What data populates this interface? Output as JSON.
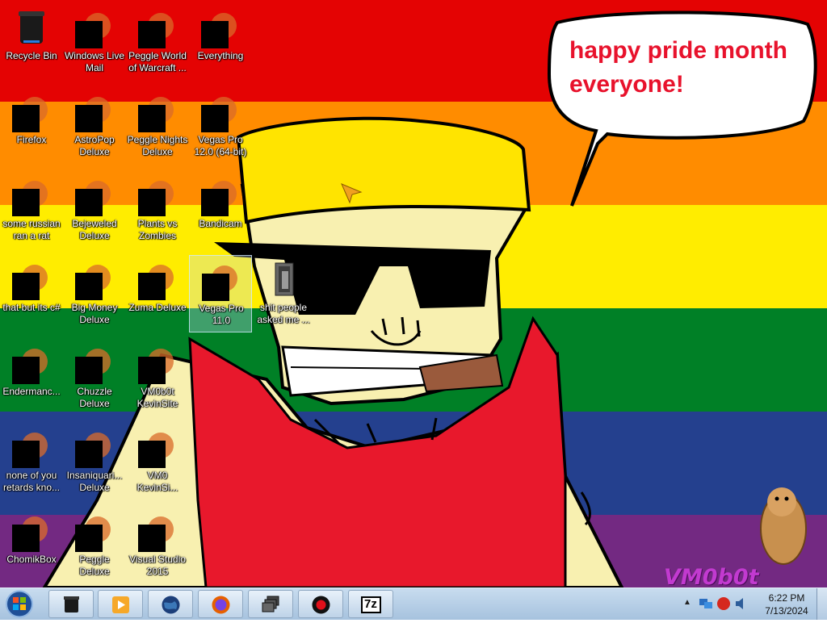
{
  "wallpaper": {
    "speech_bubble": "happy pride month everyone!",
    "watermark": "VM0b0t"
  },
  "desktop_icons": [
    {
      "label": "Recycle Bin",
      "icon": "recycle-bin-icon",
      "censored": false
    },
    {
      "label": "Windows Live Mail",
      "icon": "mail-icon",
      "censored": true
    },
    {
      "label": "Peggle World of Warcraft ...",
      "icon": "peggle-icon",
      "censored": true
    },
    {
      "label": "Everything",
      "icon": "search-icon",
      "censored": true
    },
    {
      "label": "Firefox",
      "icon": "firefox-icon",
      "censored": true
    },
    {
      "label": "AstroPop Deluxe",
      "icon": "game-icon",
      "censored": true
    },
    {
      "label": "Peggle Nights Deluxe",
      "icon": "peggle-icon",
      "censored": true
    },
    {
      "label": "Vegas Pro 12.0 (64-bit)",
      "icon": "vegas-icon",
      "censored": true
    },
    {
      "label": "some russian ran a rat",
      "icon": "app-icon",
      "censored": true
    },
    {
      "label": "Bejeweled Deluxe",
      "icon": "gem-icon",
      "censored": true
    },
    {
      "label": "Plants vs Zombies",
      "icon": "plant-icon",
      "censored": true
    },
    {
      "label": "Bandicam",
      "icon": "record-icon",
      "censored": true
    },
    {
      "label": "that but its c#",
      "icon": "window-stack-icon",
      "censored": true
    },
    {
      "label": "Big Money Deluxe",
      "icon": "money-bag-icon",
      "censored": true
    },
    {
      "label": "Zuma Deluxe",
      "icon": "zuma-icon",
      "censored": true
    },
    {
      "label": "Vegas Pro 11.0",
      "icon": "vegas-icon",
      "censored": true,
      "selected": true
    },
    {
      "label": "shit people asked me ...",
      "icon": "folder-icon",
      "censored": false
    },
    {
      "label": "Endermanc...",
      "icon": "terminal-icon",
      "censored": true
    },
    {
      "label": "Chuzzle Deluxe",
      "icon": "chuzzle-icon",
      "censored": true
    },
    {
      "label": "VM0b0t KevinSite",
      "icon": "terminal-icon",
      "censored": true
    },
    {
      "label": "none of you retards kno...",
      "icon": "app-icon",
      "censored": true
    },
    {
      "label": "Insaniquari... Deluxe",
      "icon": "fish-icon",
      "censored": true
    },
    {
      "label": "VM0 KevinSi...",
      "icon": "file-icon",
      "censored": true
    },
    {
      "label": "ChomikBox",
      "icon": "hamster-icon",
      "censored": true
    },
    {
      "label": "Peggle Deluxe",
      "icon": "peggle-icon",
      "censored": true
    },
    {
      "label": "Visual Studio 2015",
      "icon": "visual-studio-icon",
      "censored": true
    }
  ],
  "taskbar": {
    "pinned": [
      {
        "name": "recycle-bin-app",
        "icon": "recycle-bin-icon"
      },
      {
        "name": "media-player",
        "icon": "play-icon"
      },
      {
        "name": "globe-app",
        "icon": "globe-icon"
      },
      {
        "name": "firefox",
        "icon": "firefox-icon"
      },
      {
        "name": "window-stack-app",
        "icon": "window-stack-icon"
      },
      {
        "name": "bandicam",
        "icon": "record-icon"
      },
      {
        "name": "7zip",
        "icon": "7zip-icon"
      }
    ],
    "seven_zip_label": "7z",
    "tray_arrow": "▲",
    "clock_time": "6:22 PM",
    "clock_date": "7/13/2024"
  },
  "colors": {
    "red": "#e40303",
    "orange": "#ff8c00",
    "yellow": "#ffed00",
    "green": "#008026",
    "blue": "#24408e",
    "purple": "#732982"
  }
}
